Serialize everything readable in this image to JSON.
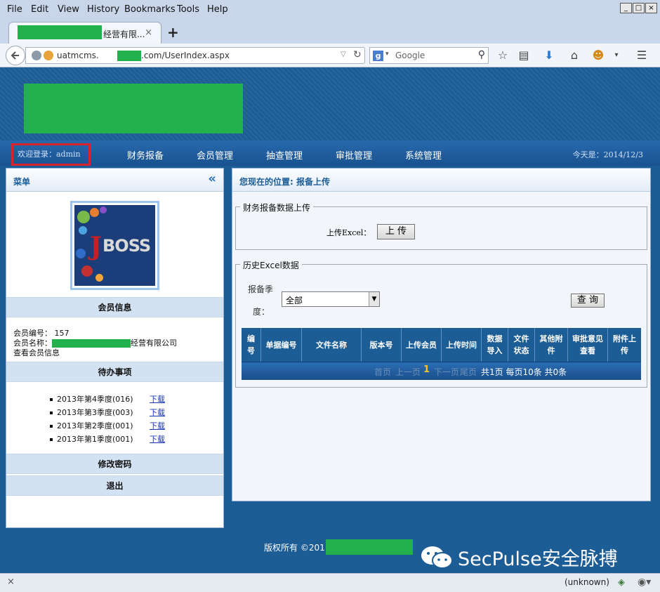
{
  "browser": {
    "menu": [
      "File",
      "Edit",
      "View",
      "History",
      "Bookmarks",
      "Tools",
      "Help"
    ],
    "window_buttons": [
      "_",
      "□",
      "×"
    ],
    "tab_title": "经营有限...",
    "tab_close": "×",
    "new_tab": "+",
    "url_prefix": "uatmcms.",
    "url_suffix": ".com/UserIndex.aspx",
    "search_placeholder": "Google",
    "status_left": "×",
    "status_text": "(unknown)"
  },
  "header": {
    "welcome": "欢迎登录：admin",
    "nav": [
      "财务报备",
      "会员管理",
      "抽查管理",
      "审批管理",
      "系统管理"
    ],
    "today": "今天是：2014/12/3"
  },
  "left": {
    "title": "菜单",
    "collapse": "«",
    "member_info_title": "会员信息",
    "member_no": "会员编号： 157",
    "member_name_label": "会员名称：",
    "member_name_suffix": "经营有限公司",
    "view_member": "查看会员信息",
    "todo_title": "待办事项",
    "todos": [
      {
        "label": "2013年第4季度(016)",
        "link": "下载"
      },
      {
        "label": "2013年第3季度(003)",
        "link": "下载"
      },
      {
        "label": "2013年第2季度(001)",
        "link": "下载"
      },
      {
        "label": "2013年第1季度(001)",
        "link": "下载"
      }
    ],
    "change_password": "修改密码",
    "logout": "退出"
  },
  "right": {
    "location": "您现在的位置: 报备上传",
    "upload_legend": "财务报备数据上传",
    "upload_label": "上传Excel：",
    "upload_button": "上 传",
    "history_legend": "历史Excel数据",
    "quarter_label_1": "报备季",
    "quarter_label_2": "度：",
    "quarter_value": "全部",
    "query_button": "查 询",
    "columns": [
      "编号",
      "单据编号",
      "文件名称",
      "版本号",
      "上传会员",
      "上传时间",
      "数据导入",
      "文件状态",
      "其他附件",
      "审批意见查看",
      "附件上传"
    ],
    "pager": {
      "first": "首页",
      "prev": "上一页",
      "current": "1",
      "next": "下一页",
      "last": "尾页",
      "info": "共1页 每页10条 共0条"
    }
  },
  "footer": {
    "copyright": "版权所有 ©2011",
    "brand": "SecPulse安全脉搏"
  }
}
